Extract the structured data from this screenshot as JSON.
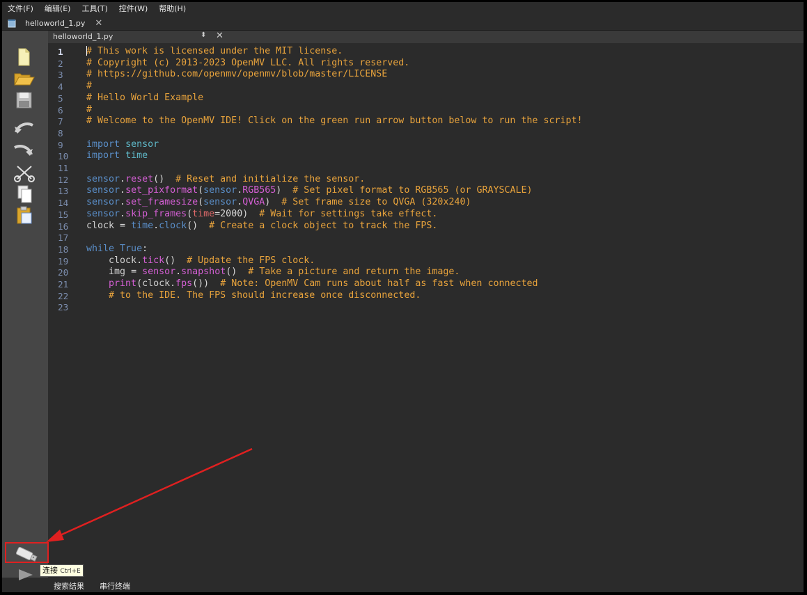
{
  "menu": [
    "文件(F)",
    "编辑(E)",
    "工具(T)",
    "控件(W)",
    "帮助(H)"
  ],
  "tab": {
    "label": "helloworld_1.py",
    "close": "✕"
  },
  "editor_header": {
    "filename": "helloworld_1.py",
    "arrows": "⬍",
    "close": "✕"
  },
  "line_numbers": [
    "1",
    "2",
    "3",
    "4",
    "5",
    "6",
    "7",
    "8",
    "9",
    "10",
    "11",
    "12",
    "13",
    "14",
    "15",
    "16",
    "17",
    "18",
    "19",
    "20",
    "21",
    "22",
    "23"
  ],
  "code": {
    "l1": "# This work is licensed under the MIT license.",
    "l2": "# Copyright (c) 2013-2023 OpenMV LLC. All rights reserved.",
    "l3": "# https://github.com/openmv/openmv/blob/master/LICENSE",
    "l4": "#",
    "l5": "# Hello World Example",
    "l6": "#",
    "l7": "# Welcome to the OpenMV IDE! Click on the green run arrow button below to run the script!",
    "import_kw": "import",
    "mod_sensor": "sensor",
    "mod_time": "time",
    "l12_comment": "# Reset and initialize the sensor.",
    "l13_comment": "# Set pixel format to RGB565 (or GRAYSCALE)",
    "l14_comment": "# Set frame size to QVGA (320x240)",
    "l15_comment": "# Wait for settings take effect.",
    "l16_comment": "# Create a clock object to track the FPS.",
    "l19_comment": "# Update the FPS clock.",
    "l20_comment": "# Take a picture and return the image.",
    "l21_comment": "# Note: OpenMV Cam runs about half as fast when connected",
    "l22_comment": "# to the IDE. The FPS should increase once disconnected."
  },
  "tooltip": {
    "label": "连接",
    "shortcut": "Ctrl+E"
  },
  "bottom_tabs": [
    "搜索结果",
    "串行终端"
  ],
  "colors": {
    "comment": "#e8a33c",
    "keyword": "#5a8ec8",
    "function": "#d45fd4",
    "annotation_red": "#e02020"
  }
}
